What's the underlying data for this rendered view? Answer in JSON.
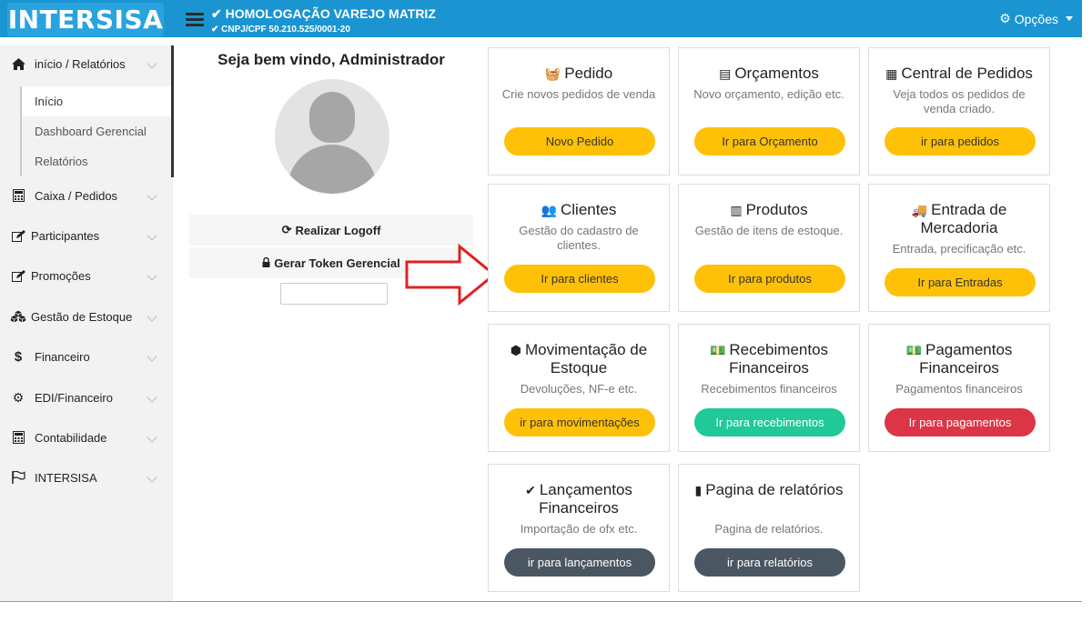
{
  "header": {
    "logo": "INTERSISA",
    "company": "✔ HOMOLOGAÇÃO VAREJO MATRIZ",
    "cnpj": "✔ CNPJ/CPF 50.210.525/0001-20",
    "options": "Opções"
  },
  "sidebar": {
    "items": [
      {
        "icon": "home-icon",
        "label": "início / Relatórios"
      },
      {
        "icon": "calculator-icon",
        "label": "Caixa / Pedidos"
      },
      {
        "icon": "edit-icon",
        "label": "Participantes"
      },
      {
        "icon": "edit-icon",
        "label": "Promoções"
      },
      {
        "icon": "cubes-icon",
        "label": "Gestão de Estoque"
      },
      {
        "icon": "dollar-icon",
        "label": "Financeiro"
      },
      {
        "icon": "cogs-icon",
        "label": "EDI/Financeiro"
      },
      {
        "icon": "calculator-icon",
        "label": "Contabilidade"
      },
      {
        "icon": "flag-icon",
        "label": "INTERSISA"
      }
    ],
    "subitems": [
      "Início",
      "Dashboard Gerencial",
      "Relatórios"
    ]
  },
  "welcome": "Seja bem vindo, Administrador",
  "actions": {
    "logoff": "Realizar Logoff",
    "token": "Gerar Token Gerencial"
  },
  "cards": [
    {
      "title": "Pedido",
      "icon": "basket-icon",
      "desc": "Crie novos pedidos de venda",
      "button": "Novo Pedido",
      "color": "#ffc107"
    },
    {
      "title": "Orçamentos",
      "icon": "file-icon",
      "desc": "Novo orçamento, edição etc.",
      "button": "Ir para Orçamento",
      "color": "#ffc107"
    },
    {
      "title": "Central de Pedidos",
      "icon": "calculator-icon",
      "desc": "Veja todos os pedidos de venda criado.",
      "button": "ir para pedidos",
      "color": "#ffc107"
    },
    {
      "title": "Clientes",
      "icon": "users-icon",
      "desc": "Gestão do cadastro de clientes.",
      "button": "Ir para clientes",
      "color": "#ffc107"
    },
    {
      "title": "Produtos",
      "icon": "barcode-icon",
      "desc": "Gestão de itens de estoque.",
      "button": "Ir para produtos",
      "color": "#ffc107"
    },
    {
      "title": "Entrada de Mercadoria",
      "icon": "truck-icon",
      "desc": "Entrada, precificação etc.",
      "button": "Ir para Entradas",
      "color": "#ffc107"
    },
    {
      "title": "Movimentação de Estoque",
      "icon": "cubes-icon",
      "desc": "Devoluções, NF-e etc.",
      "button": "ir para movimentações",
      "color": "#ffc107"
    },
    {
      "title": "Recebimentos Financeiros",
      "icon": "money-icon",
      "desc": "Recebimentos financeiros",
      "button": "Ir para recebimentos",
      "color": "#20c997"
    },
    {
      "title": "Pagamentos Financeiros",
      "icon": "money-icon",
      "desc": "Pagamentos financeiros",
      "button": "Ir para pagamentos",
      "color": "#dc3545"
    },
    {
      "title": "Lançamentos Financeiros",
      "icon": "check-icon",
      "desc": "Importação de ofx etc.",
      "button": "ir para lançamentos",
      "color": "#4a5662"
    },
    {
      "title": "Pagina de relatórios",
      "icon": "document-icon",
      "desc": "Pagina de relatórios.",
      "button": "ir para relatórios",
      "color": "#4a5662"
    }
  ]
}
